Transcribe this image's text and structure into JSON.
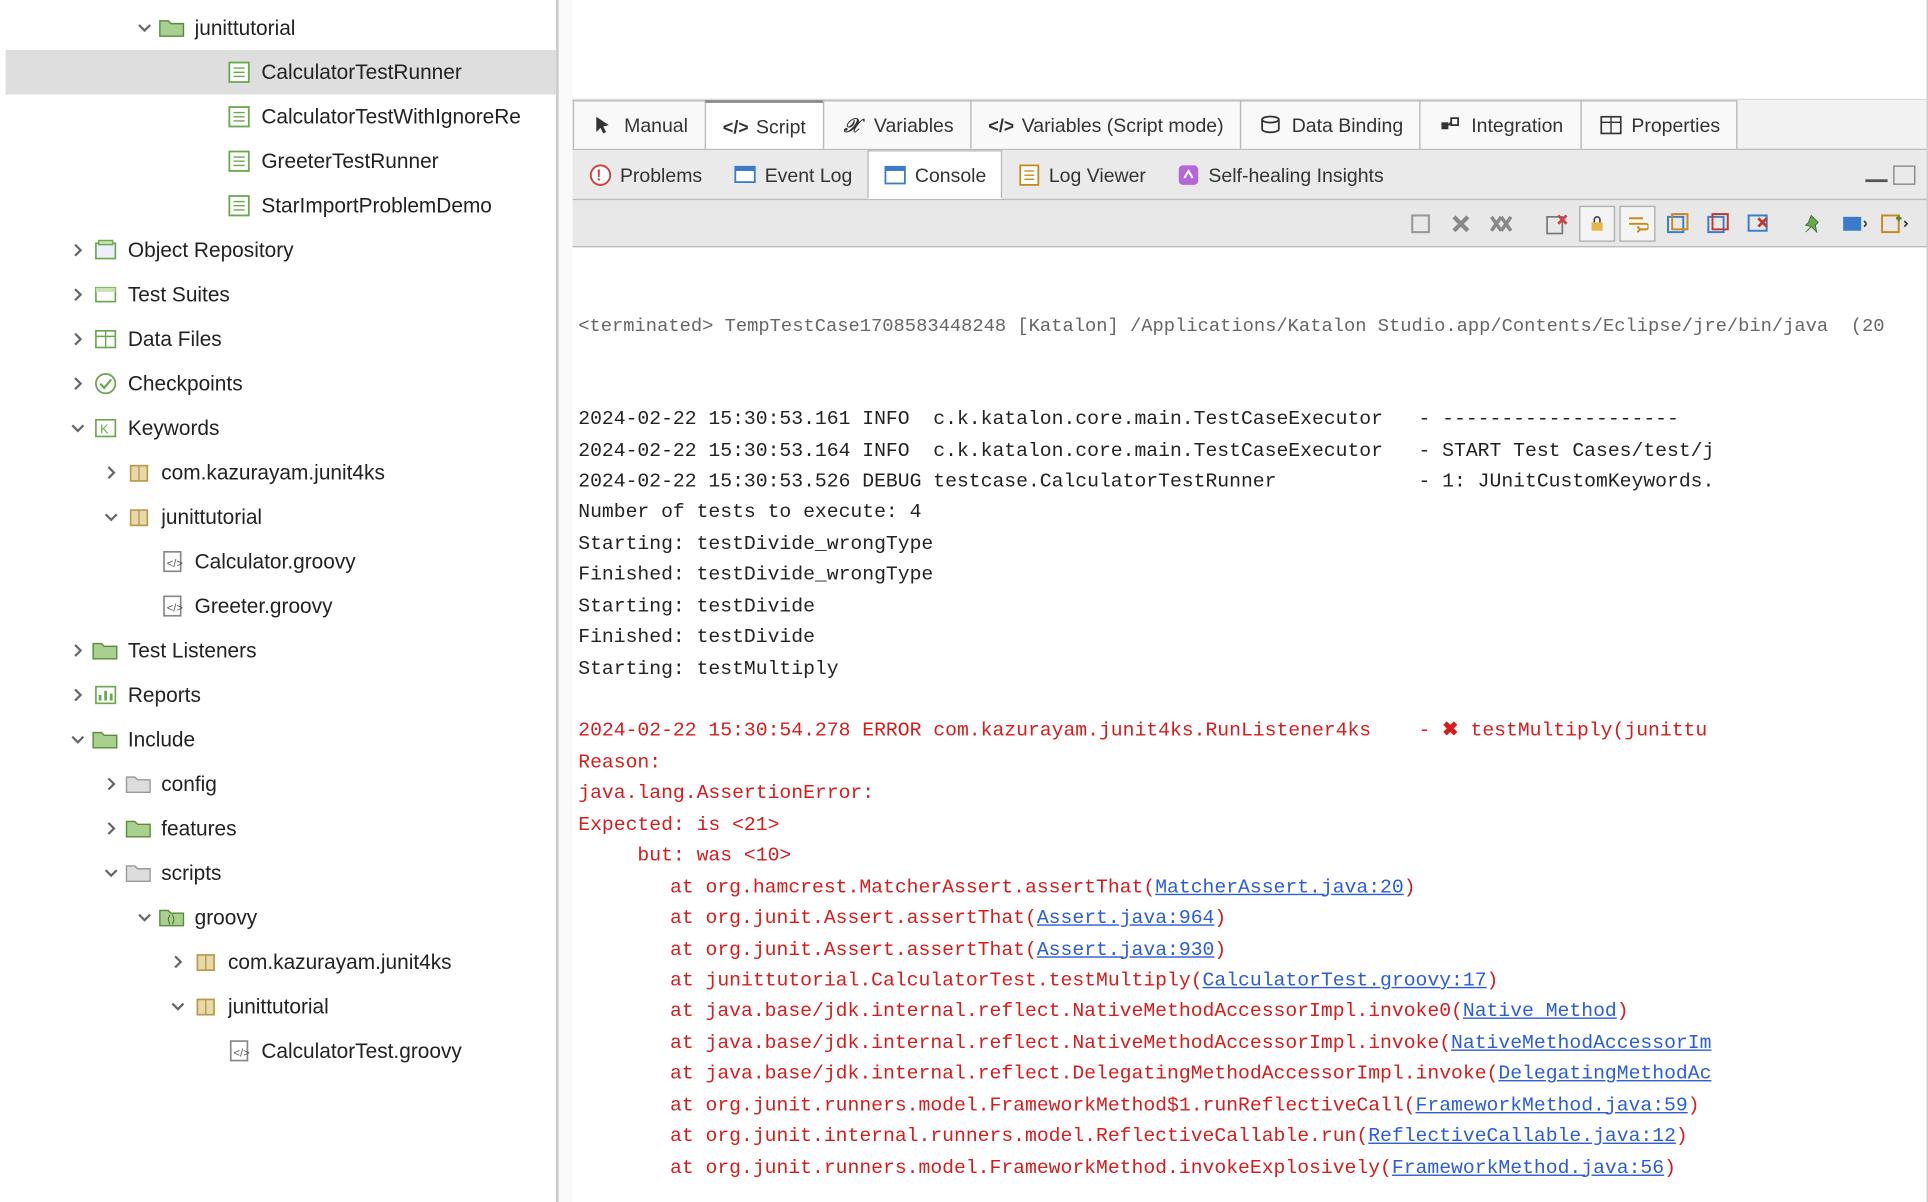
{
  "tree": {
    "items": [
      {
        "level": 3,
        "expand": "down",
        "icon": "folder-green",
        "label": "junittutorial"
      },
      {
        "level": 5,
        "expand": "",
        "icon": "testcase",
        "label": "CalculatorTestRunner",
        "selected": true
      },
      {
        "level": 5,
        "expand": "",
        "icon": "testcase",
        "label": "CalculatorTestWithIgnoreRe"
      },
      {
        "level": 5,
        "expand": "",
        "icon": "testcase",
        "label": "GreeterTestRunner"
      },
      {
        "level": 5,
        "expand": "",
        "icon": "testcase",
        "label": "StarImportProblemDemo"
      },
      {
        "level": 1,
        "expand": "right",
        "icon": "repo",
        "label": "Object Repository"
      },
      {
        "level": 1,
        "expand": "right",
        "icon": "suites",
        "label": "Test Suites"
      },
      {
        "level": 1,
        "expand": "right",
        "icon": "datafiles",
        "label": "Data Files"
      },
      {
        "level": 1,
        "expand": "right",
        "icon": "checkpoints",
        "label": "Checkpoints"
      },
      {
        "level": 1,
        "expand": "down",
        "icon": "keywords",
        "label": "Keywords"
      },
      {
        "level": 2,
        "expand": "right",
        "icon": "package",
        "label": "com.kazurayam.junit4ks"
      },
      {
        "level": 2,
        "expand": "down",
        "icon": "package",
        "label": "junittutorial"
      },
      {
        "level": 3,
        "expand": "",
        "icon": "script",
        "label": "Calculator.groovy"
      },
      {
        "level": 3,
        "expand": "",
        "icon": "script",
        "label": "Greeter.groovy"
      },
      {
        "level": 1,
        "expand": "right",
        "icon": "folder-green",
        "label": "Test Listeners"
      },
      {
        "level": 1,
        "expand": "right",
        "icon": "reports",
        "label": "Reports"
      },
      {
        "level": 1,
        "expand": "down",
        "icon": "folder-green",
        "label": "Include"
      },
      {
        "level": 2,
        "expand": "right",
        "icon": "folder-gray",
        "label": "config"
      },
      {
        "level": 2,
        "expand": "right",
        "icon": "folder-green",
        "label": "features"
      },
      {
        "level": 2,
        "expand": "down",
        "icon": "folder-gray",
        "label": "scripts"
      },
      {
        "level": 3,
        "expand": "down",
        "icon": "folder-src",
        "label": "groovy"
      },
      {
        "level": 4,
        "expand": "right",
        "icon": "package",
        "label": "com.kazurayam.junit4ks"
      },
      {
        "level": 4,
        "expand": "down",
        "icon": "package",
        "label": "junittutorial"
      },
      {
        "level": 5,
        "expand": "",
        "icon": "script",
        "label": "CalculatorTest.groovy"
      }
    ]
  },
  "topTabs": [
    {
      "icon": "pointer",
      "label": "Manual"
    },
    {
      "icon": "code",
      "label": "Script",
      "active": true
    },
    {
      "icon": "xvar",
      "label": "Variables"
    },
    {
      "icon": "code",
      "label": "Variables (Script mode)"
    },
    {
      "icon": "db",
      "label": "Data Binding"
    },
    {
      "icon": "integration",
      "label": "Integration"
    },
    {
      "icon": "table",
      "label": "Properties"
    }
  ],
  "panelTabs": [
    {
      "icon": "problems",
      "label": "Problems"
    },
    {
      "icon": "eventlog",
      "label": "Event Log"
    },
    {
      "icon": "console",
      "label": "Console",
      "active": true
    },
    {
      "icon": "logviewer",
      "label": "Log Viewer"
    },
    {
      "icon": "selfheal",
      "label": "Self-healing Insights"
    }
  ],
  "console": {
    "process": "<terminated> TempTestCase1708583448248 [Katalon] /Applications/Katalon Studio.app/Contents/Eclipse/jre/bin/java  (20",
    "lines": [
      {
        "t": "2024-02-22 15:30:53.161 INFO  c.k.katalon.core.main.TestCaseExecutor   - --------------------"
      },
      {
        "t": "2024-02-22 15:30:53.164 INFO  c.k.katalon.core.main.TestCaseExecutor   - START Test Cases/test/j"
      },
      {
        "t": "2024-02-22 15:30:53.526 DEBUG testcase.CalculatorTestRunner            - 1: JUnitCustomKeywords."
      },
      {
        "t": "Number of tests to execute: 4"
      },
      {
        "t": "Starting: testDivide_wrongType"
      },
      {
        "t": "Finished: testDivide_wrongType"
      },
      {
        "t": "Starting: testDivide"
      },
      {
        "t": "Finished: testDivide"
      },
      {
        "t": "Starting: testMultiply"
      }
    ],
    "error": {
      "line0": "2024-02-22 15:30:54.278 ERROR com.kazurayam.junit4ks.RunListener4ks    - ",
      "xmark": "✖",
      "line0b": " testMultiply(junittu",
      "reason": "Reason:",
      "assertion": "java.lang.AssertionError:",
      "expected": "Expected: is <21>",
      "but": "     but: was <10>",
      "frames": [
        {
          "pre": "at org.hamcrest.MatcherAssert.assertThat(",
          "link": "MatcherAssert.java:20",
          "post": ")"
        },
        {
          "pre": "at org.junit.Assert.assertThat(",
          "link": "Assert.java:964",
          "post": ")"
        },
        {
          "pre": "at org.junit.Assert.assertThat(",
          "link": "Assert.java:930",
          "post": ")"
        },
        {
          "pre": "at junittutorial.CalculatorTest.testMultiply(",
          "link": "CalculatorTest.groovy:17",
          "post": ")"
        },
        {
          "pre": "at java.base/jdk.internal.reflect.NativeMethodAccessorImpl.invoke0(",
          "link": "Native Method",
          "post": ")"
        },
        {
          "pre": "at java.base/jdk.internal.reflect.NativeMethodAccessorImpl.invoke(",
          "link": "NativeMethodAccessorIm",
          "post": ""
        },
        {
          "pre": "at java.base/jdk.internal.reflect.DelegatingMethodAccessorImpl.invoke(",
          "link": "DelegatingMethodAc",
          "post": ""
        },
        {
          "pre": "at org.junit.runners.model.FrameworkMethod$1.runReflectiveCall(",
          "link": "FrameworkMethod.java:59",
          "post": ")"
        },
        {
          "pre": "at org.junit.internal.runners.model.ReflectiveCallable.run(",
          "link": "ReflectiveCallable.java:12",
          "post": ")"
        },
        {
          "pre": "at org.junit.runners.model.FrameworkMethod.invokeExplosively(",
          "link": "FrameworkMethod.java:56",
          "post": ")"
        }
      ]
    }
  }
}
